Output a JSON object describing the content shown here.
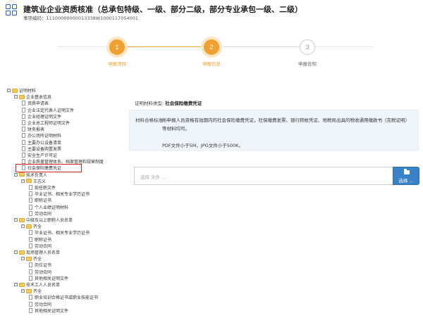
{
  "header": {
    "title": "建筑业企业资质核准（总承包特级、一级、部分二级，部分专业承包一级、二级）",
    "code_line": "事项编码：11100000000013338W1000117054001",
    "logo_icon": "app-grid-logo-icon"
  },
  "steps": [
    {
      "number": "1",
      "label": "申报须知",
      "state": "done"
    },
    {
      "number": "2",
      "label": "申报信息",
      "state": "active"
    },
    {
      "number": "3",
      "label": "申报告知",
      "state": "pending"
    }
  ],
  "colors": {
    "accent": "#f0a030",
    "accent_ring": "#fde6c4",
    "pending": "#cccccc",
    "highlight": "#d9241e",
    "button": "#3a82c7",
    "criteria_bg": "#f0f4fb"
  },
  "tree": [
    {
      "label": "证明材料",
      "depth": 0,
      "kind": "folder",
      "toggle": "-"
    },
    {
      "label": "企业基本信息",
      "depth": 1,
      "kind": "folder",
      "toggle": "-"
    },
    {
      "label": "资质申请表",
      "depth": 2,
      "kind": "file"
    },
    {
      "label": "企业法定代表人证明文件",
      "depth": 2,
      "kind": "file"
    },
    {
      "label": "企业经理证明文件",
      "depth": 2,
      "kind": "file"
    },
    {
      "label": "企业总工程师证明文件",
      "depth": 2,
      "kind": "file"
    },
    {
      "label": "财务报表",
      "depth": 2,
      "kind": "file"
    },
    {
      "label": "办公场所证明材料",
      "depth": 2,
      "kind": "file"
    },
    {
      "label": "主要办公设备清单",
      "depth": 2,
      "kind": "file"
    },
    {
      "label": "主要设备购置发票",
      "depth": 2,
      "kind": "file"
    },
    {
      "label": "安全生产许可证",
      "depth": 2,
      "kind": "file"
    },
    {
      "label": "企业质量管理体系、档案管理和规章制度",
      "depth": 2,
      "kind": "file"
    },
    {
      "label": "社会保险缴费凭证",
      "depth": 2,
      "kind": "file",
      "selected": true
    },
    {
      "label": "技术负责人",
      "depth": 1,
      "kind": "folder",
      "toggle": "-"
    },
    {
      "label": "王志义",
      "depth": 2,
      "kind": "folder",
      "toggle": "-"
    },
    {
      "label": "现任职文件",
      "depth": 3,
      "kind": "file"
    },
    {
      "label": "毕业证书、相关专业学历证书",
      "depth": 3,
      "kind": "file"
    },
    {
      "label": "职称证书",
      "depth": 3,
      "kind": "file"
    },
    {
      "label": "个人业绩证明材料",
      "depth": 3,
      "kind": "file"
    },
    {
      "label": "劳动合同",
      "depth": 3,
      "kind": "file"
    },
    {
      "label": "中级及以上职称人员名单",
      "depth": 1,
      "kind": "folder",
      "toggle": "-"
    },
    {
      "label": "齐全",
      "depth": 2,
      "kind": "folder",
      "toggle": "-"
    },
    {
      "label": "毕业证书、相关专业学历证书",
      "depth": 3,
      "kind": "file"
    },
    {
      "label": "职称证书",
      "depth": 3,
      "kind": "file"
    },
    {
      "label": "劳动合同",
      "depth": 3,
      "kind": "file"
    },
    {
      "label": "现场管理人员名单",
      "depth": 1,
      "kind": "folder",
      "toggle": "-"
    },
    {
      "label": "齐全",
      "depth": 2,
      "kind": "folder",
      "toggle": "-"
    },
    {
      "label": "岗位证书",
      "depth": 3,
      "kind": "file"
    },
    {
      "label": "劳动合同",
      "depth": 3,
      "kind": "file"
    },
    {
      "label": "其他相关证明文件",
      "depth": 3,
      "kind": "file"
    },
    {
      "label": "技术工人人员名单",
      "depth": 1,
      "kind": "folder",
      "toggle": "-"
    },
    {
      "label": "齐全",
      "depth": 2,
      "kind": "folder",
      "toggle": "-"
    },
    {
      "label": "职业培训合格证书或职业技能证书",
      "depth": 3,
      "kind": "file"
    },
    {
      "label": "劳动合同",
      "depth": 3,
      "kind": "file"
    },
    {
      "label": "其他相关证明文件",
      "depth": 3,
      "kind": "file"
    }
  ],
  "detail": {
    "cert_type_label": "证明材料类型:",
    "cert_type_value": "社会保险缴费凭证",
    "criteria_label": "材料合格标准:",
    "criteria_text": "所申报人员资格有效期内的社会保险缴费凭证，社保缴费发票、银行转帐凭证、地税局出具的税收通用缴款书（完税证明）等材料均可。",
    "criteria_note": "PDF文件小于5M，JPG文件小于500K。"
  },
  "upload": {
    "placeholder": "选择 文件 ...",
    "button_label": "选择 ...",
    "button_icon": "folder-open-icon"
  }
}
